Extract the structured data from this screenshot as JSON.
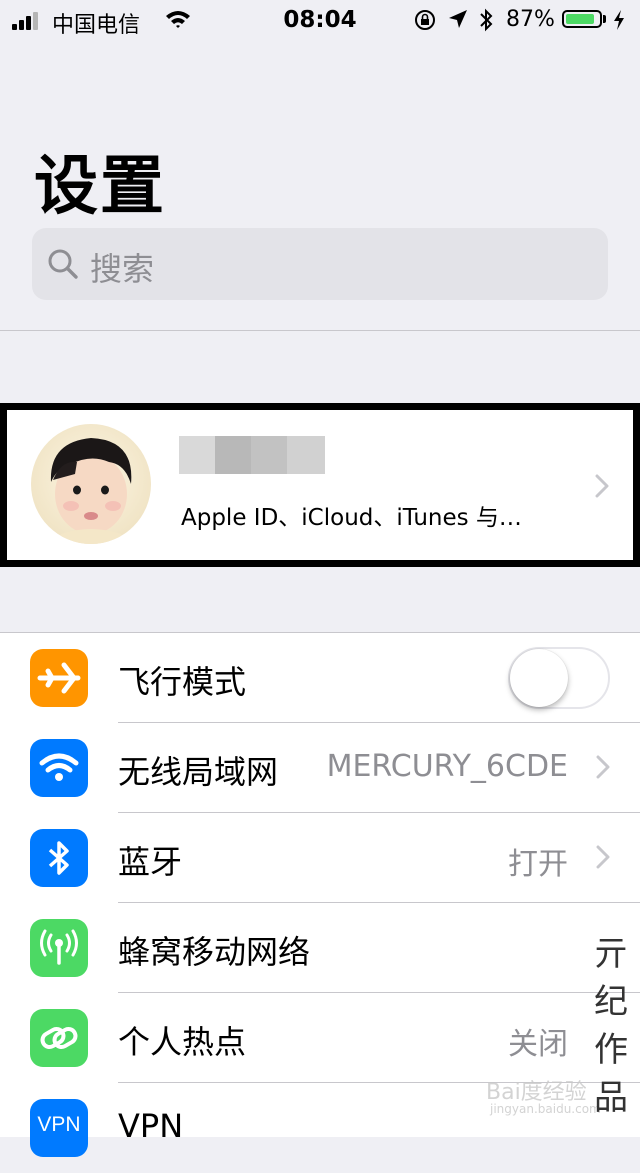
{
  "status_bar": {
    "carrier": "中国电信",
    "time": "08:04",
    "battery_percent": "87%",
    "battery_level": 0.87,
    "battery_color": "#4cd964"
  },
  "header": {
    "title": "设置"
  },
  "search": {
    "placeholder": "搜索",
    "icon": "magnifier"
  },
  "profile": {
    "subtitle": "Apple ID、iCloud、iTunes 与…"
  },
  "rows": [
    {
      "label": "飞行模式",
      "icon": "airplane-icon",
      "color": "#ff9500",
      "toggle": false
    },
    {
      "label": "无线局域网",
      "icon": "wifi-icon",
      "color": "#007aff",
      "value": "MERCURY_6CDE"
    },
    {
      "label": "蓝牙",
      "icon": "bluetooth-icon",
      "color": "#007aff",
      "value": "打开"
    },
    {
      "label": "蜂窝移动网络",
      "icon": "antenna-icon",
      "color": "#4cd964"
    },
    {
      "label": "个人热点",
      "icon": "hotspot-icon",
      "color": "#4cd964",
      "value": "关闭"
    },
    {
      "label": "VPN",
      "icon": "vpn-icon",
      "color": "#007aff",
      "icon_text": "VPN"
    }
  ],
  "watermark": {
    "chars": [
      "亓",
      "纪",
      "作",
      "品"
    ],
    "logo": "Bai度经验",
    "logo_sub": "jingyan.baidu.com"
  }
}
